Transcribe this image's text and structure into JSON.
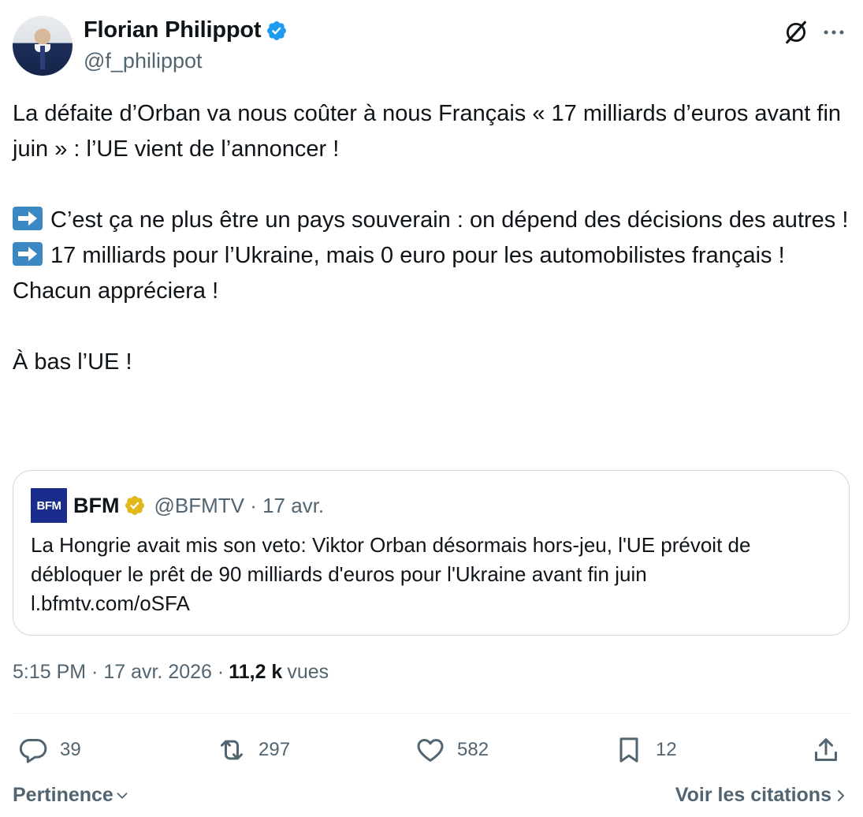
{
  "author": {
    "name": "Florian Philippot",
    "handle": "@f_philippot"
  },
  "tweet": {
    "line1": "La défaite d’Orban va nous coûter à nous Français « 17 milliards d’euros avant fin juin » : l’UE vient de l’annoncer !",
    "line2": "C’est ça ne plus être un pays souverain : on dépend des décisions des autres !",
    "line3": "17 milliards pour l’Ukraine, mais 0 euro pour les automobilistes français !",
    "line4": "Chacun appréciera !",
    "line5": "À bas l’UE !"
  },
  "quote": {
    "logo_text": "BFM",
    "name": "BFM",
    "handle_date": "@BFMTV · 17 avr.",
    "text": "La Hongrie avait mis son veto: Viktor Orban désormais hors-jeu, l'UE prévoit de débloquer le prêt de 90 milliards d'euros pour l'Ukraine avant fin juin",
    "link": "l.bfmtv.com/oSFA"
  },
  "meta": {
    "time_date": "5:15 PM · 17 avr. 2026 ·",
    "views_count": "11,2 k",
    "views_label": "vues"
  },
  "actions": {
    "replies": "39",
    "reposts": "297",
    "likes": "582",
    "bookmarks": "12"
  },
  "footer": {
    "sort_label": "Pertinence",
    "citations_label": "Voir les citations"
  },
  "colors": {
    "verified_blue": "#1d9bf0",
    "verified_gold": "#e2b719",
    "muted": "#536471",
    "bfm_blue": "#1a2d8c"
  }
}
